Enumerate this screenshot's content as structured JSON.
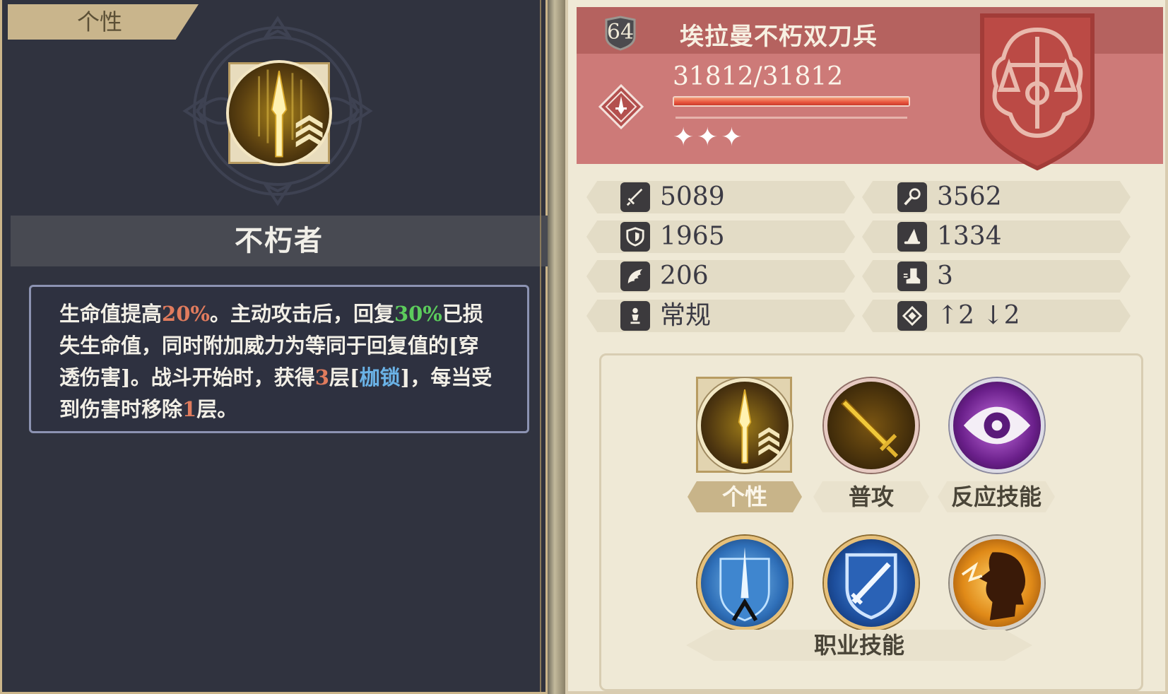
{
  "left_panel": {
    "tab_label": "个性",
    "trait_icon": "spear-rank-up-icon",
    "trait_name": "不朽者",
    "description": [
      {
        "text": "生命值提高",
        "color": "normal"
      },
      {
        "text": "20%",
        "color": "red"
      },
      {
        "text": "。主动攻击后，回复",
        "color": "normal"
      },
      {
        "text": "30%",
        "color": "green"
      },
      {
        "text": "已损失生命值，同时附加威力为等同于回复值的[穿透伤害]。战斗开始时，获得",
        "color": "normal"
      },
      {
        "text": "3",
        "color": "red"
      },
      {
        "text": "层[",
        "color": "normal"
      },
      {
        "text": "枷锁",
        "color": "blue"
      },
      {
        "text": "]，每当受到伤害时移除",
        "color": "normal"
      },
      {
        "text": "1",
        "color": "red"
      },
      {
        "text": "层。",
        "color": "normal"
      }
    ]
  },
  "unit": {
    "level": "64",
    "name": "埃拉曼不朽双刀兵",
    "hp": "31812/31812",
    "hp_fraction": 1.0,
    "stars": "✦✦✦",
    "class_icon": "dagger-diamond-icon",
    "crest_icon": "scales-sword-crest-icon"
  },
  "stats": {
    "left": [
      {
        "icon": "sword-attack-icon",
        "value": "5089"
      },
      {
        "icon": "shield-defense-icon",
        "value": "1965"
      },
      {
        "icon": "wing-speed-icon",
        "value": "206"
      },
      {
        "icon": "person-stance-icon",
        "value": "常规"
      }
    ],
    "right": [
      {
        "icon": "staff-magic-icon",
        "value": "3562"
      },
      {
        "icon": "wizard-hat-icon",
        "value": "1334"
      },
      {
        "icon": "boot-move-icon",
        "value": "3"
      },
      {
        "icon": "diamond-range-icon",
        "value": "↑2 ↓2"
      }
    ]
  },
  "skills": {
    "personality_label": "个性",
    "normal_attack_label": "普攻",
    "reaction_label": "反应技能",
    "class_skills_label": "职业技能",
    "icons": [
      "spear-rank-up-icon",
      "golden-sword-icon",
      "purple-eye-icon",
      "ice-sword-shield-icon",
      "blue-shield-sword-icon",
      "roaring-head-icon"
    ]
  },
  "colors": {
    "left_bg": "#30333f",
    "right_bg": "#efe9d6",
    "header_red": "#cd7a78",
    "highlight_red": "#e07b5d",
    "highlight_green": "#5ccc5c",
    "highlight_blue": "#6ab2e6"
  }
}
